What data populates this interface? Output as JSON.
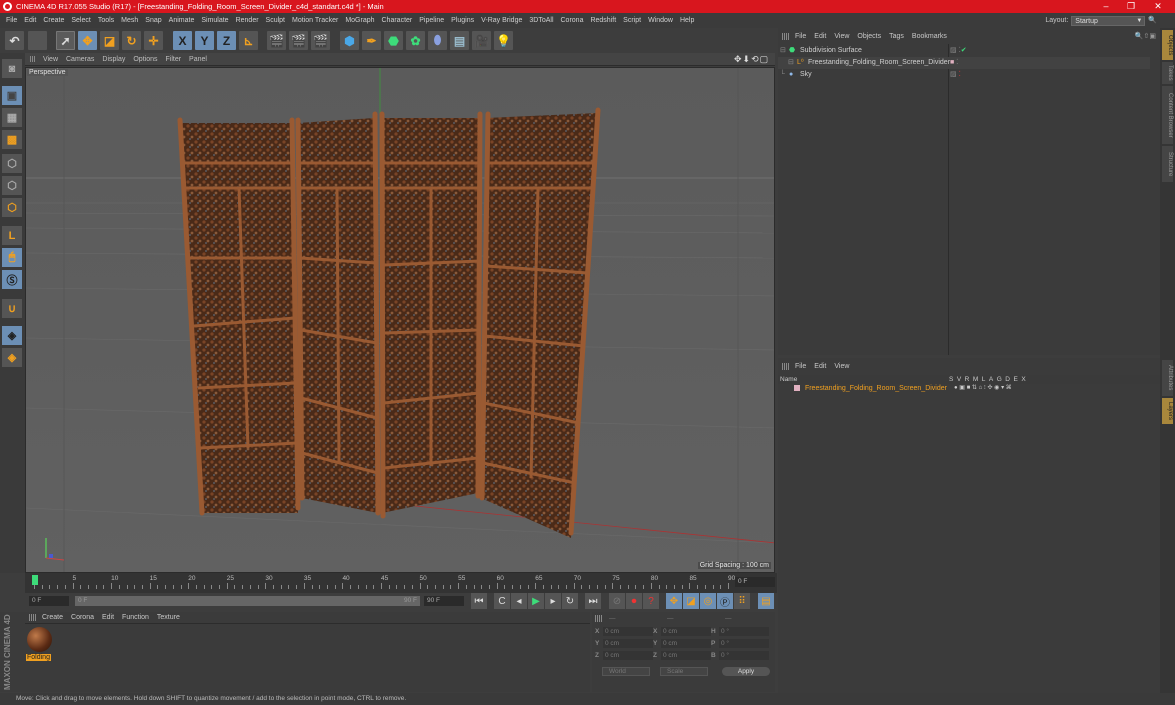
{
  "window": {
    "title": "CINEMA 4D R17.055 Studio (R17) - [Freestanding_Folding_Room_Screen_Divider_c4d_standart.c4d *] - Main",
    "controls": {
      "minimize": "–",
      "restore": "❐",
      "close": "✕"
    }
  },
  "menubar": {
    "items": [
      "File",
      "Edit",
      "Create",
      "Select",
      "Tools",
      "Mesh",
      "Snap",
      "Animate",
      "Simulate",
      "Render",
      "Sculpt",
      "Motion Tracker",
      "MoGraph",
      "Character",
      "Pipeline",
      "Plugins",
      "V-Ray Bridge",
      "3DToAll",
      "Corona",
      "Redshift",
      "Script",
      "Window",
      "Help"
    ],
    "layout_label": "Layout:",
    "layout_value": "Startup"
  },
  "toolbar": {
    "icons": [
      "undo-icon",
      "redo-icon",
      "select-arrow-icon",
      "move-icon",
      "scale-icon",
      "rotate-icon",
      "add-icon",
      "x-axis-icon",
      "y-axis-icon",
      "z-axis-icon",
      "coordinate-system-icon",
      "render-view-icon",
      "render-picture-viewer-icon",
      "render-settings-icon",
      "cube-icon",
      "pen-icon",
      "subdivision-icon",
      "cloner-icon",
      "deformer-icon",
      "floor-icon",
      "camera-icon",
      "light-icon"
    ],
    "axis_labels": {
      "x": "X",
      "y": "Y",
      "z": "Z"
    }
  },
  "left_tools": [
    "make-editable-icon",
    "texture-mode-icon",
    "workplane-icon",
    "points-mode-icon",
    "edges-mode-icon",
    "polygons-mode-icon",
    "axis-mode-icon",
    "tweak-mode-icon",
    "solo-icon",
    "magnet-icon",
    "lock-workplane-icon",
    "snap-settings-icon"
  ],
  "viewport": {
    "menu": [
      "View",
      "Cameras",
      "Display",
      "Options",
      "Filter",
      "Panel"
    ],
    "label": "Perspective",
    "grid_spacing": "Grid Spacing : 100 cm",
    "nav_icons": "✥⬇⟲▢"
  },
  "timeline": {
    "ticks": [
      "0",
      "5",
      "10",
      "15",
      "20",
      "25",
      "30",
      "35",
      "40",
      "45",
      "50",
      "55",
      "60",
      "65",
      "70",
      "75",
      "80",
      "85",
      "90"
    ],
    "current_frame_field": "0 F"
  },
  "transport": {
    "start_field": "0 F",
    "slider_start": "0 F",
    "slider_end": "90 F",
    "end_field": "90 F"
  },
  "material_manager": {
    "menu": [
      "Create",
      "Corona",
      "Edit",
      "Function",
      "Texture"
    ],
    "materials": [
      {
        "name": "Folding"
      }
    ]
  },
  "coordinates": {
    "headers": [
      "—",
      "—",
      "—"
    ],
    "rows": [
      {
        "a1": "X",
        "v1": "0 cm",
        "a2": "X",
        "v2": "0 cm",
        "a3": "H",
        "v3": "0 °"
      },
      {
        "a1": "Y",
        "v1": "0 cm",
        "a2": "Y",
        "v2": "0 cm",
        "a3": "P",
        "v3": "0 °"
      },
      {
        "a1": "Z",
        "v1": "0 cm",
        "a2": "Z",
        "v2": "0 cm",
        "a3": "B",
        "v3": "0 °"
      }
    ],
    "mode_dropdown": "World",
    "scale_dropdown": "Scale",
    "apply_label": "Apply"
  },
  "object_manager": {
    "menu": [
      "File",
      "Edit",
      "View",
      "Objects",
      "Tags",
      "Bookmarks"
    ],
    "objects": [
      {
        "name": "Subdivision Surface",
        "icon": "subdivision-icon",
        "flags": "✔"
      },
      {
        "name": "Freestanding_Folding_Room_Screen_Divider",
        "icon": "null-object-icon",
        "flags": ""
      },
      {
        "name": "Sky",
        "icon": "sky-icon",
        "flags": ""
      }
    ]
  },
  "attribute_manager": {
    "menu": [
      "File",
      "Edit",
      "View"
    ],
    "name_header": "Name",
    "columns": "SVRMLAGDEX",
    "row_name": "Freestanding_Folding_Room_Screen_Divider"
  },
  "side_tabs": {
    "top": [
      "Objects",
      "Takes",
      "Content Browser",
      "Structure"
    ],
    "bottom": [
      "Attributes",
      "Layers"
    ]
  },
  "status": {
    "text": "Move: Click and drag to move elements. Hold down SHIFT to quantize movement / add to the selection in point mode, CTRL to remove."
  },
  "branding": "MAXON CINEMA 4D",
  "colors": {
    "title_red": "#d8161e",
    "accent_orange": "#f0a020",
    "tool_blue": "#6c8fb5"
  }
}
